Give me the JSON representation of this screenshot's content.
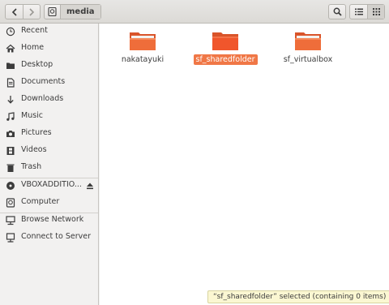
{
  "header": {
    "current_location": "media"
  },
  "sidebar": {
    "places": [
      {
        "label": "Recent",
        "icon": "clock-icon"
      },
      {
        "label": "Home",
        "icon": "home-icon"
      },
      {
        "label": "Desktop",
        "icon": "folder-icon"
      },
      {
        "label": "Documents",
        "icon": "document-icon"
      },
      {
        "label": "Downloads",
        "icon": "download-icon"
      },
      {
        "label": "Music",
        "icon": "music-icon"
      },
      {
        "label": "Pictures",
        "icon": "camera-icon"
      },
      {
        "label": "Videos",
        "icon": "film-icon"
      },
      {
        "label": "Trash",
        "icon": "trash-icon"
      }
    ],
    "devices": [
      {
        "label": "VBOXADDITIO...",
        "icon": "disc-icon"
      },
      {
        "label": "Computer",
        "icon": "drive-icon"
      }
    ],
    "network": [
      {
        "label": "Browse Network",
        "icon": "network-icon"
      },
      {
        "label": "Connect to Server",
        "icon": "server-icon"
      }
    ]
  },
  "files": [
    {
      "name": "nakatayuki",
      "selected": false
    },
    {
      "name": "sf_sharedfolder",
      "selected": true
    },
    {
      "name": "sf_virtualbox",
      "selected": false
    }
  ],
  "status": {
    "text": "“sf_sharedfolder” selected  (containing 0 items)"
  },
  "colors": {
    "accent": "#f07746",
    "folder": "#ef6d3a"
  }
}
